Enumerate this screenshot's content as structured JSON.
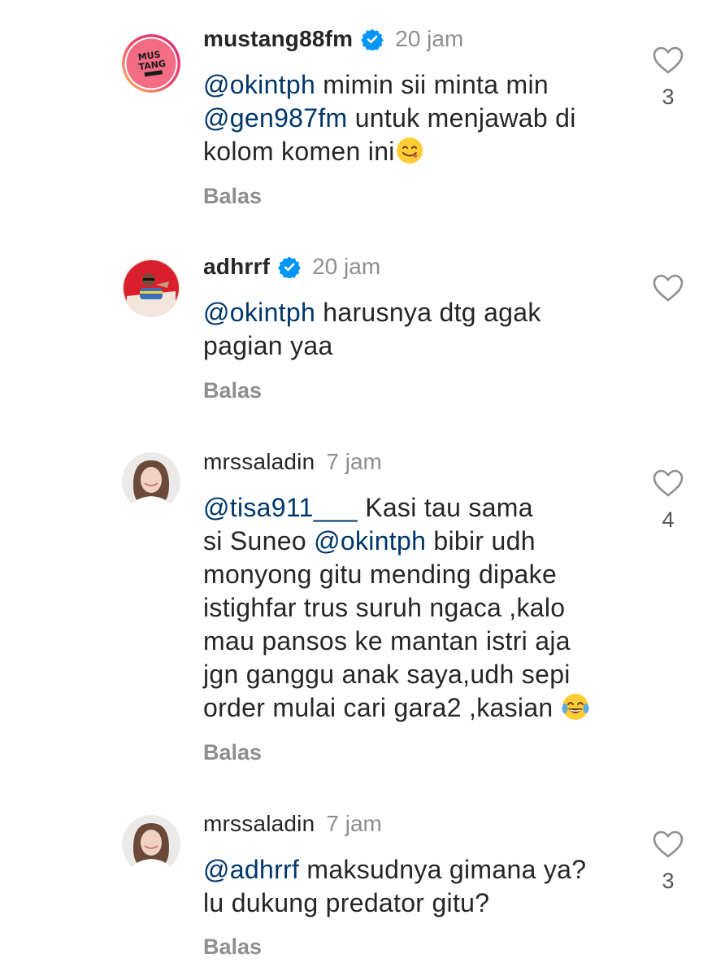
{
  "comments": [
    {
      "username": "mustang88fm",
      "verified": true,
      "time": "20 jam",
      "avatar": "mustang-logo-avatar",
      "lines": [
        [
          {
            "m": "@okintph"
          },
          {
            "t": " mimin sii minta min"
          }
        ],
        [
          {
            "m": "@gen987fm"
          },
          {
            "t": " untuk menjawab di"
          }
        ],
        [
          {
            "t": "kolom komen ini"
          },
          {
            "e": "face-savoring-food-emoji"
          }
        ]
      ],
      "reply": "Balas",
      "likes": "3"
    },
    {
      "username": "adhrrf",
      "verified": true,
      "time": "20 jam",
      "avatar": "adhrrf-photo-avatar",
      "lines": [
        [
          {
            "m": "@okintph"
          },
          {
            "t": " harusnya dtg agak"
          }
        ],
        [
          {
            "t": "pagian yaa"
          }
        ]
      ],
      "reply": "Balas",
      "likes": ""
    },
    {
      "username": "mrssaladin",
      "verified": false,
      "time": "7 jam",
      "avatar": "mrssaladin-photo-avatar",
      "lines": [
        [
          {
            "m": "@tisa911___"
          },
          {
            "t": " Kasi tau sama"
          }
        ],
        [
          {
            "t": "si Suneo "
          },
          {
            "m": "@okintph"
          },
          {
            "t": " bibir udh"
          }
        ],
        [
          {
            "t": "monyong gitu mending dipake"
          }
        ],
        [
          {
            "t": "istighfar trus suruh ngaca ,kalo"
          }
        ],
        [
          {
            "t": "mau pansos ke mantan istri aja"
          }
        ],
        [
          {
            "t": "jgn ganggu anak saya,udh sepi"
          }
        ],
        [
          {
            "t": "order mulai cari gara2 ,kasian "
          },
          {
            "e": "tears-of-joy-emoji"
          }
        ]
      ],
      "reply": "Balas",
      "likes": "4"
    },
    {
      "username": "mrssaladin",
      "verified": false,
      "time": "7 jam",
      "avatar": "mrssaladin-photo-avatar",
      "lines": [
        [
          {
            "m": "@adhrrf"
          },
          {
            "t": " maksudnya gimana ya?"
          }
        ],
        [
          {
            "t": "lu dukung predator gitu?"
          }
        ]
      ],
      "reply": "Balas",
      "likes": "3"
    }
  ],
  "colors": {
    "mention": "#00376b",
    "secondary": "#8e8e8e",
    "verified": "#0095f6",
    "text": "#262626"
  }
}
